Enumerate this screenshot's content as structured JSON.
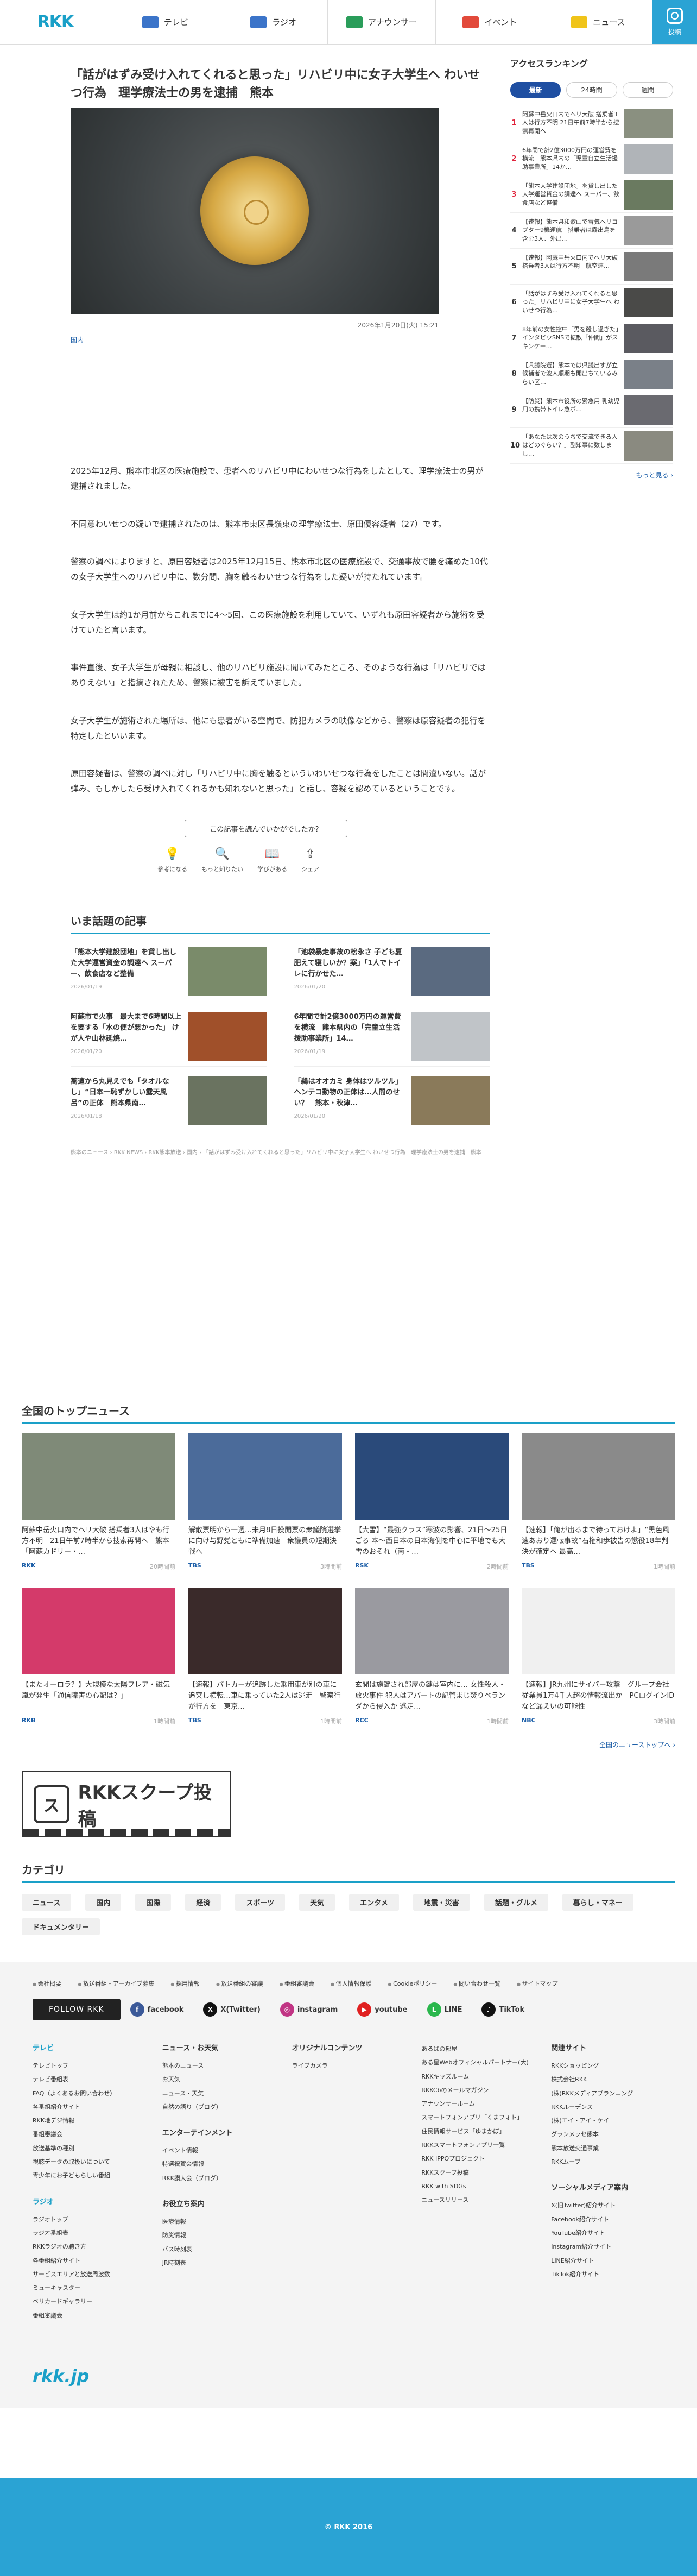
{
  "header": {
    "logo": "RKK",
    "nav": [
      {
        "label": "テレビ",
        "icon": "tv-icon",
        "color": "#3b74c9"
      },
      {
        "label": "ラジオ",
        "icon": "radio-icon",
        "color": "#3b74c9"
      },
      {
        "label": "アナウンサー",
        "icon": "announcer-icon",
        "color": "#2a9d5a"
      },
      {
        "label": "イベント",
        "icon": "event-icon",
        "color": "#e24a3b"
      },
      {
        "label": "ニュース",
        "icon": "news-icon",
        "color": "#f0c419"
      }
    ],
    "scoop_label": "投稿"
  },
  "article": {
    "title": "「話がはずみ受け入れてくれると思った」リハビリ中に女子大学生へ わいせつ行為　理学療法士の男を逮捕　熊本",
    "date": "2026年1月20日(火) 15:21",
    "category": "国内",
    "paragraphs": [
      "2025年12月、熊本市北区の医療施設で、患者へのリハビリ中にわいせつな行為をしたとして、理学療法士の男が逮捕されました。",
      "不同意わいせつの疑いで逮捕されたのは、熊本市東区長嶺東の理学療法士、原田優容疑者（27）です。",
      "警察の調べによりますと、原田容疑者は2025年12月15日、熊本市北区の医療施設で、交通事故で腰を痛めた10代の女子大学生へのリハビリ中に、数分間、胸を触るわいせつな行為をした疑いが持たれています。",
      "女子大学生は約1か月前からこれまでに4～5回、この医療施設を利用していて、いずれも原田容疑者から施術を受けていたと言います。",
      "事件直後、女子大学生が母親に相談し、他のリハビリ施設に聞いてみたところ、そのような行為は「リハビリではありえない」と指摘されたため、警察に被害を訴えていました。",
      "女子大学生が施術された場所は、他にも患者がいる空間で、防犯カメラの映像などから、警察は原容疑者の犯行を特定したといいます。",
      "原田容疑者は、警察の調べに対し「リハビリ中に胸を触るといういわいせつな行為をしたことは間違いない。話が弾み、もしかしたら受け入れてくれるかも知れないと思った」と話し、容疑を認めているということです。"
    ]
  },
  "feedback": {
    "question": "この記事を読んでいかがでしたか？",
    "buttons": [
      {
        "label": "参考になる",
        "icon": "lightbulb-icon",
        "glyph": "💡"
      },
      {
        "label": "もっと知りたい",
        "icon": "magnifier-icon",
        "glyph": "🔍"
      },
      {
        "label": "学びがある",
        "icon": "book-icon",
        "glyph": "📖"
      },
      {
        "label": "シェア",
        "icon": "share-icon",
        "glyph": "⇪"
      }
    ]
  },
  "topics": {
    "heading": "いま話題の記事",
    "items": [
      {
        "title": "「熊本大学建設団地」を貸し出した大学運営資金の調達へ スーパー、飲食店など整備",
        "date": "2026/01/19",
        "thumb": "#7a8b6a"
      },
      {
        "title": "「池袋暴走事故の松永さ 子ども夏肥えて寝しいか？案」「1人でトイレに行かせた…",
        "date": "2026/01/20",
        "thumb": "#5a6a80"
      },
      {
        "title": "阿蘇市で火事　最大まで6時間以上を要する「水の便が悪かった」 けが人や山林延焼…",
        "date": "2026/01/20",
        "thumb": "#a0502a"
      },
      {
        "title": "6年間で計2億3000万円の運営費を横流　熊本県内の「完童立生活援助事業所」14…",
        "date": "2026/01/19",
        "thumb": "#c0c4c8"
      },
      {
        "title": "蕎這から丸見えでも「タオルなし」“日本一恥ずかしい露天風呂”の正体　熊本県南…",
        "date": "2026/01/18",
        "thumb": "#6a7360"
      },
      {
        "title": "「鵜はオオカミ 身体はツルツル」ヘンテコ動物の正体は…人間のせい？　熊本・秋津…",
        "date": "2026/01/20",
        "thumb": "#8a7a5a"
      }
    ]
  },
  "breadcrumb": "熊本のニュース › RKK NEWS › RKK熊本放送 › 国内 › 「話がはずみ受け入れてくれると思った」リハビリ中に女子大学生へ わいせつ行為　理学療法士の男を逮捕　熊本",
  "national": {
    "heading": "全国のトップニュース",
    "items": [
      {
        "title": "阿蘇中岳火口内でヘリ大破 搭乗者3人はやも行方不明　21日午前7時半から捜索再開へ　熊本「阿蘇カドリー・…",
        "source": "RKK",
        "date": "20時間前",
        "img": "#7f8a78"
      },
      {
        "title": "解散票明から一週…来月8日投開票の衆議院選挙に向け与野党ともに準備加速　衆議員の短期決戦へ",
        "source": "TBS",
        "date": "3時間前",
        "img": "#4b6b9a"
      },
      {
        "title": "【大雪】“最強クラス”寒波の影響、21日～25日ごろ 本～西日本の日本海側を中心に平地でも大雪のおそれ（南・…",
        "source": "RSK",
        "date": "2時間前",
        "img": "#2a4a7a"
      },
      {
        "title": "【速報】「俺が出るまで待っておけよ」“黒色風速あおり運転事故”石権和歩被告の懲役18年判決が確定へ 最高…",
        "source": "TBS",
        "date": "1時間前",
        "img": "#8a8a8a"
      },
      {
        "title": "【またオーロラ？】大規模な太陽フレア・磁気嵐が発生「通信障害の心配は？」",
        "source": "RKB",
        "date": "1時間前",
        "img": "#d43a6a"
      },
      {
        "title": "【速報】パトカーが追跡した乗用車が別の車に追突し横転…車に乗っていた2人は逃走　警察行が行方を　東京…",
        "source": "TBS",
        "date": "1時間前",
        "img": "#3a2a2a"
      },
      {
        "title": "玄関は施錠され部屋の鍵は室内に… 女性殺人・放火事件 犯人はアパートの記管まじ焚りベランダから侵入か 逃走…",
        "source": "RCC",
        "date": "1時間前",
        "img": "#9a9aa0"
      },
      {
        "title": "【速報】JR九州にサイバー攻撃　グループ会社従業員1万4千人超の情報流出か　PCログインIDなど漏えいの可能性",
        "source": "NBC",
        "date": "3時間前",
        "img": "#f0f0f0"
      }
    ],
    "more": "全国のニューストップへ ›"
  },
  "scoop_banner": {
    "icon_text": "ス",
    "text": "RKKスクープ投稿"
  },
  "categories": {
    "heading": "カテゴリ",
    "items": [
      "ニュース",
      "国内",
      "国際",
      "経済",
      "スポーツ",
      "天気",
      "エンタメ",
      "地震・災害",
      "話題・グルメ",
      "暮らし・マネー",
      "ドキュメンタリー"
    ]
  },
  "footer": {
    "util_links": [
      "会社概要",
      "放送番組・アーカイブ募集",
      "採用情報",
      "放送番組の審議",
      "番組審議会",
      "個人情報保護",
      "Cookieポリシー",
      "問い合わせ一覧",
      "サイトマップ"
    ],
    "follow": "FOLLOW RKK",
    "sns": [
      {
        "name": "facebook",
        "color": "#3b5998",
        "glyph": "f"
      },
      {
        "name": "X(Twitter)",
        "color": "#111111",
        "glyph": "X"
      },
      {
        "name": "instagram",
        "color": "#c13584",
        "glyph": "◎"
      },
      {
        "name": "youtube",
        "color": "#e02020",
        "glyph": "▶"
      },
      {
        "name": "LINE",
        "color": "#2ab74c",
        "glyph": "L"
      },
      {
        "name": "TikTok",
        "color": "#111111",
        "glyph": "♪"
      }
    ],
    "col1": {
      "title": "テレビ",
      "items": [
        "テレビトップ",
        "テレビ番組表",
        "FAQ（よくあるお問い合わせ）",
        "各番組紹介サイト",
        "RKK地デジ情報",
        "番組審議会",
        "放送基準の種別",
        "視聴データの取扱いについて",
        "青少年にお子どもらしい番組"
      ],
      "title2": "ラジオ",
      "items2": [
        "ラジオトップ",
        "ラジオ番組表",
        "RKKラジオの聴き方",
        "各番組紹介サイト",
        "サービスエリアと放送周波数",
        "ミューキャスター",
        "ベリカードギャラリー",
        "番組審議会"
      ]
    },
    "col2": {
      "title": "ニュース・お天気",
      "items": [
        "熊本のニュース",
        "お天気",
        "ニュース・天気",
        "自然の語り（ブログ）"
      ],
      "title2": "エンターテインメント",
      "items2": [
        "イベント情報",
        "特選祝賀会情報",
        "RKK讃大会（ブログ）"
      ],
      "title3": "お役立ち案内",
      "items3": [
        "医療情報",
        "防災情報",
        "バス時刻表",
        "JR時刻表"
      ]
    },
    "col3": {
      "title": "オリジナルコンテンツ",
      "items": [
        "ライブカメラ"
      ]
    },
    "col4": {
      "items": [
        "あるばの部屋",
        "ある星Webオフィシャルパートナー(大)",
        "RKKキッズルーム",
        "RKKCbのメールマガジン",
        "アナウンサールーム",
        "スマートフォンアプリ「くまフォト」",
        "住民情報サービス「ゆまかぽ」",
        "RKKスマートフォンアプリ一覧",
        "RKK IPPOプロジェクト",
        "RKKスクープ投稿",
        "RKK with SDGs",
        "ニュースリリース"
      ]
    },
    "col5": {
      "title": "関連サイト",
      "items": [
        "RKKショッピング",
        "株式会社RKK",
        "(株)RKKメディアプランニング",
        "RKKルーデンス",
        "(株)エイ・アイ・ケイ",
        "グランメッセ熊本",
        "熊本放送交通事業",
        "RKKムーブ"
      ],
      "title2": "ソーシャルメディア案内",
      "items2": [
        "X(旧Twitter)紹介サイト",
        "Facebook紹介サイト",
        "YouTube紹介サイト",
        "Instagram紹介サイト",
        "LINE紹介サイト",
        "TikTok紹介サイト"
      ]
    },
    "brand": "rkk.jp",
    "copyright": "© RKK 2016"
  },
  "ranking": {
    "heading": "アクセスランキング",
    "tabs": [
      "最新",
      "24時間",
      "週間"
    ],
    "items": [
      {
        "no": "1",
        "text": "阿蘇中岳火口内でヘリ大破 搭乗者3人は行方不明 21日午前7時半から捜索再開へ",
        "thumb": "#8a9080"
      },
      {
        "no": "2",
        "text": "6年間で計2億3000万円の運営費を横流　熊本県内の「児童自立生活援助事業所」14か…",
        "thumb": "#b0b4b8"
      },
      {
        "no": "3",
        "text": "「熊本大学建設団地」を貸し出した大学運営資金の調達へ スーパー、飲食店など整備",
        "thumb": "#6a7a60"
      },
      {
        "no": "4",
        "text": "【速報】熊本県和歌山で雪気ヘリコプター9機運航　搭乗者は霧出島を含む3人、外出…",
        "thumb": "#9a9a9a"
      },
      {
        "no": "5",
        "text": "【速報】阿蘇中岳火口内でヘリ大破 搭乗者3人は行方不明　航空連…",
        "thumb": "#7a7a7a"
      },
      {
        "no": "6",
        "text": "「話がはずみ受け入れてくれると思った」リハビリ中に女子大学生へ わいせつ行為…",
        "thumb": "#4a4a48"
      },
      {
        "no": "7",
        "text": "8年前の女性控中「男を殺し過ぎた」　インタビウSNSで拡散「仲間」がスキンケー…",
        "thumb": "#5a5a60"
      },
      {
        "no": "8",
        "text": "【県議院選】熊本では県議出すが立候補者で波人順期も開出ちているみらい区…",
        "thumb": "#7a8088"
      },
      {
        "no": "9",
        "text": "【防災】熊本市役所の緊急用 乳幼児用の携帯トイレ急ポ…",
        "thumb": "#6a6a70"
      },
      {
        "no": "10",
        "text": "「あなたは次のうちで交流できる人はどのぐらい？」副知事に数しまし…",
        "thumb": "#8a8a80"
      }
    ],
    "more": "もっと見る ›"
  }
}
